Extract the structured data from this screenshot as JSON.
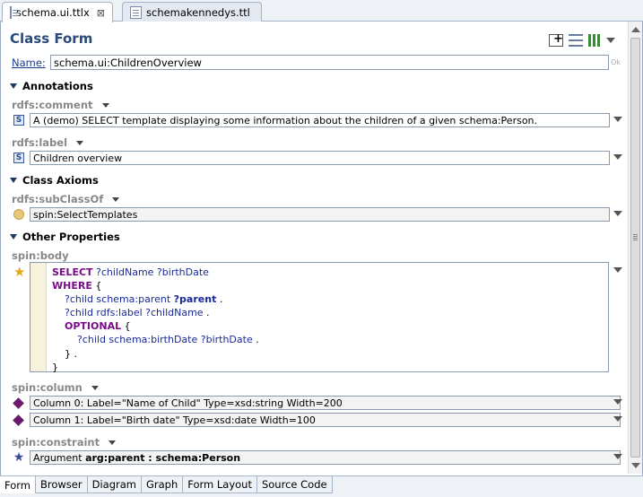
{
  "editor_tabs": [
    {
      "label": "schema.ui.ttlx",
      "active": true,
      "close": "⊠"
    },
    {
      "label": "schemakennedys.ttl",
      "active": false
    }
  ],
  "form": {
    "title": "Class Form",
    "name_label": "Name:",
    "name_value": "schema.ui:ChildrenOverview",
    "ok_label": "Ok"
  },
  "sections": {
    "annotations": "Annotations",
    "class_axioms": "Class Axioms",
    "other_properties": "Other Properties"
  },
  "properties": {
    "comment": {
      "label": "rdfs:comment",
      "value": "A (demo) SELECT template displaying some information about the children of a given schema:Person.",
      "icon": "S"
    },
    "label": {
      "label": "rdfs:label",
      "value": "Children overview",
      "icon": "S"
    },
    "subclassof": {
      "label": "rdfs:subClassOf",
      "value": "spin:SelectTemplates"
    },
    "body": {
      "label": "spin:body"
    },
    "column": {
      "label": "spin:column",
      "values": [
        "Column 0: Label=\"Name of Child\" Type=xsd:string Width=200",
        "Column 1: Label=\"Birth date\" Type=xsd:date Width=100"
      ]
    },
    "constraint": {
      "label": "spin:constraint",
      "prefix": "Argument ",
      "value": "arg:parent : schema:Person"
    }
  },
  "sparql": {
    "l1_kw": "SELECT",
    "l1_rest": " ?childName ?birthDate",
    "l2_kw": "WHERE",
    "l2_rest": " {",
    "l3_a": "    ?child schema:parent ",
    "l3_b": "?parent",
    "l3_c": " .",
    "l4_a": "    ?child rdfs:label ",
    "l4_b": "?childName",
    "l4_c": " .",
    "l5_kw": "OPTIONAL",
    "l5_rest": " {",
    "l6_a": "        ?child schema:birthDate ",
    "l6_b": "?birthDate",
    "l6_c": " .",
    "l7": "    } .",
    "l8": "}"
  },
  "bottom_tabs": [
    "Form",
    "Browser",
    "Diagram",
    "Graph",
    "Form Layout",
    "Source Code"
  ]
}
